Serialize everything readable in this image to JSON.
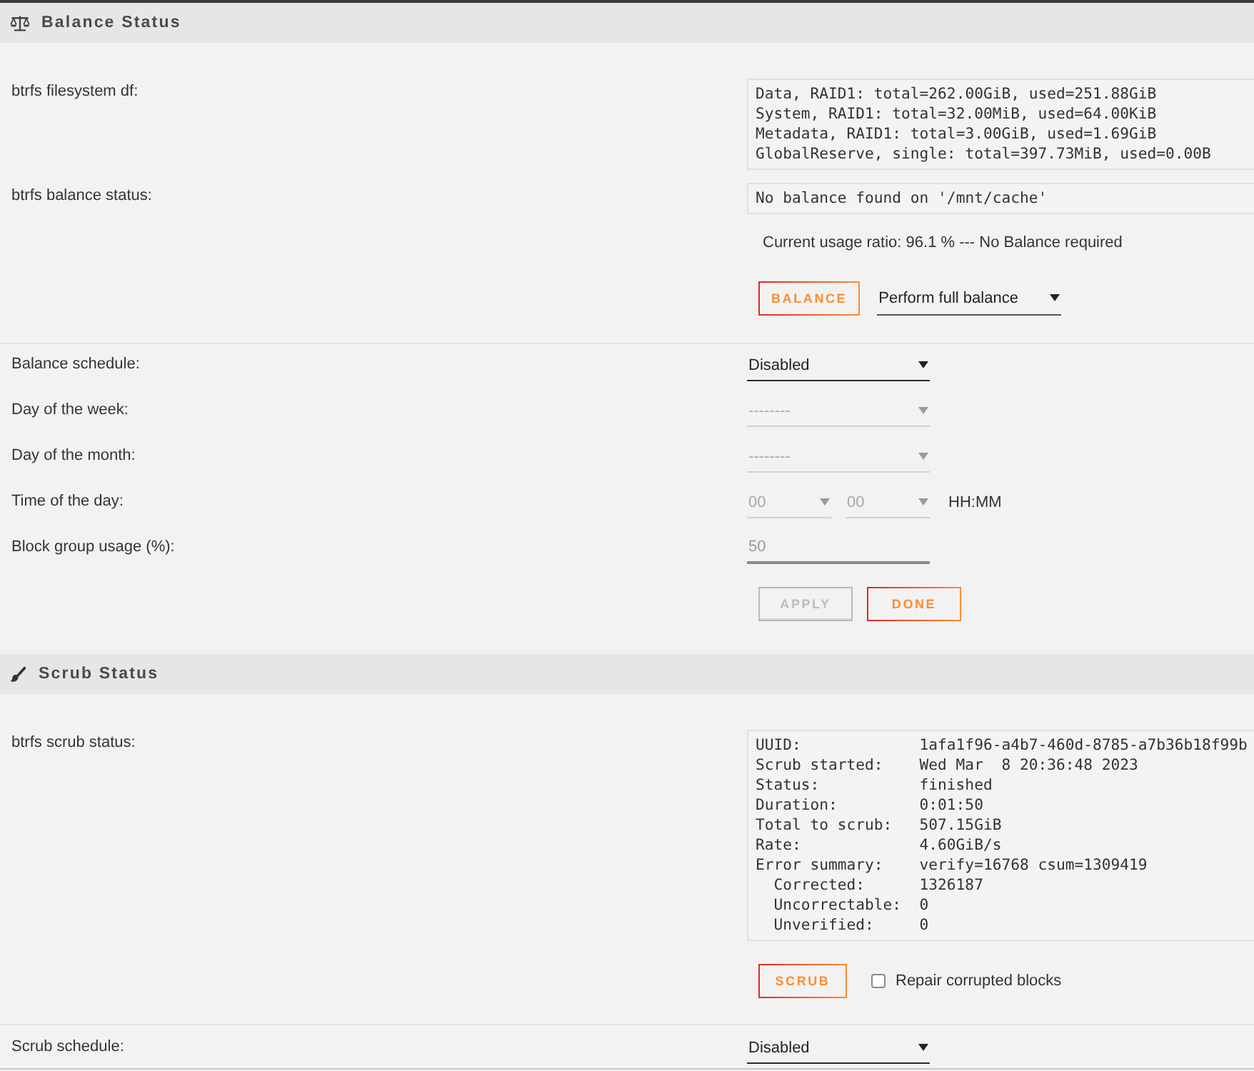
{
  "balance": {
    "title": "Balance Status",
    "df": {
      "label": "btrfs filesystem df:",
      "lines": [
        "Data, RAID1: total=262.00GiB, used=251.88GiB",
        "System, RAID1: total=32.00MiB, used=64.00KiB",
        "Metadata, RAID1: total=3.00GiB, used=1.69GiB",
        "GlobalReserve, single: total=397.73MiB, used=0.00B"
      ]
    },
    "status": {
      "label": "btrfs balance status:",
      "output": "No balance found on '/mnt/cache'"
    },
    "usage_note": "Current usage ratio: 96.1 % --- No Balance required",
    "balance_button": {
      "label": "BALANCE"
    },
    "mode_select": {
      "value": "Perform full balance"
    },
    "schedule": [
      {
        "kind": "select",
        "label": "Balance schedule:",
        "value": "Disabled",
        "disabled": false
      },
      {
        "kind": "select",
        "label": "Day of the week:",
        "value": "--------",
        "disabled": true
      },
      {
        "kind": "select",
        "label": "Day of the month:",
        "value": "--------",
        "disabled": true
      },
      {
        "kind": "time",
        "label": "Time of the day:",
        "hour": "00",
        "minute": "00",
        "hint": "HH:MM",
        "disabled": true
      },
      {
        "kind": "input",
        "label": "Block group usage (%):",
        "value": "50",
        "disabled": true
      }
    ],
    "buttons": [
      {
        "label": "APPLY",
        "disabled": true
      },
      {
        "label": "DONE",
        "disabled": false
      }
    ]
  },
  "scrub": {
    "title": "Scrub Status",
    "status": {
      "label": "btrfs scrub status:",
      "entries": [
        {
          "key": "UUID:",
          "value": "1afa1f96-a4b7-460d-8785-a7b36b18f99b"
        },
        {
          "key": "Scrub started:",
          "value": "Wed Mar  8 20:36:48 2023"
        },
        {
          "key": "Status:",
          "value": "finished"
        },
        {
          "key": "Duration:",
          "value": "0:01:50"
        },
        {
          "key": "Total to scrub:",
          "value": "507.15GiB"
        },
        {
          "key": "Rate:",
          "value": "4.60GiB/s"
        },
        {
          "key": "Error summary:",
          "value": "verify=16768 csum=1309419",
          "children": [
            {
              "key": "Corrected:",
              "value": "1326187"
            },
            {
              "key": "Uncorrectable:",
              "value": "0"
            },
            {
              "key": "Unverified:",
              "value": "0"
            }
          ]
        }
      ]
    },
    "scrub_button": {
      "label": "SCRUB"
    },
    "repair": {
      "label": "Repair corrupted blocks",
      "checked": false
    },
    "schedule": [
      {
        "kind": "select",
        "label": "Scrub schedule:",
        "value": "Disabled",
        "disabled": false
      }
    ]
  }
}
